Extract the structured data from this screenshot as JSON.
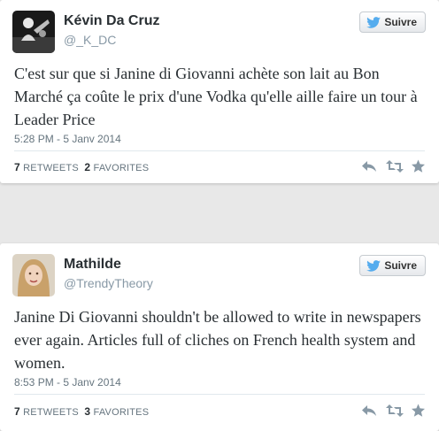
{
  "tweets": [
    {
      "name": "Kévin Da Cruz",
      "handle": "@_K_DC",
      "follow_label": "Suivre",
      "text": "C'est sur que si Janine di Giovanni achète son lait au Bon Marché ça coûte le prix d'une Vodka qu'elle aille faire un tour à Leader Price",
      "timestamp": "5:28 PM - 5 Janv 2014",
      "retweets_count": "7",
      "retweets_label": "RETWEETS",
      "favorites_count": "2",
      "favorites_label": "FAVORITES",
      "icons": [
        "reply-icon",
        "retweet-icon",
        "favorite-star-icon"
      ]
    },
    {
      "name": "Mathilde",
      "handle": "@TrendyTheory",
      "follow_label": "Suivre",
      "text": "Janine Di Giovanni shouldn't be allowed to write in newspapers ever again. Articles full of cliches on French health system and women.",
      "timestamp": "8:53 PM - 5 Janv 2014",
      "retweets_count": "7",
      "retweets_label": "RETWEETS",
      "favorites_count": "3",
      "favorites_label": "FAVORITES",
      "icons": [
        "reply-icon",
        "retweet-icon",
        "favorite-star-icon"
      ]
    }
  ],
  "colors": {
    "bird": "#55acee",
    "action_icons": "#8899a6",
    "text": "#292f33",
    "muted": "#8899a6"
  }
}
